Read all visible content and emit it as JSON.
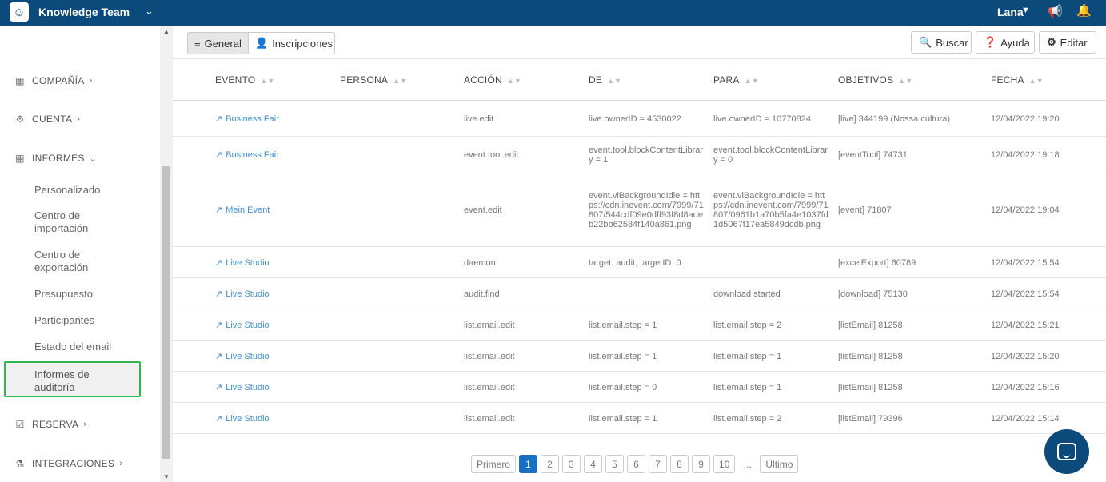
{
  "topbar": {
    "team": "Knowledge Team",
    "user": "Lana"
  },
  "sidebar": {
    "sections": [
      {
        "label": "COMPAÑÍA",
        "icon": "building-icon",
        "chevron": "›"
      },
      {
        "label": "CUENTA",
        "icon": "gear-icon",
        "chevron": "›"
      },
      {
        "label": "INFORMES",
        "icon": "report-icon",
        "chevron": "⌄"
      },
      {
        "label": "RESERVA",
        "icon": "calendar-icon",
        "chevron": "›"
      },
      {
        "label": "INTEGRACIONES",
        "icon": "flask-icon",
        "chevron": "›"
      }
    ],
    "subitems": [
      "Personalizado",
      "Centro de importación",
      "Centro de exportación",
      "Presupuesto",
      "Participantes",
      "Estado del email",
      "Informes de auditoría"
    ]
  },
  "toolbar": {
    "general": "General",
    "inscripciones": "Inscripciones",
    "buscar": "Buscar",
    "ayuda": "Ayuda",
    "editar": "Editar"
  },
  "table": {
    "headers": [
      "EVENTO",
      "PERSONA",
      "ACCIÓN",
      "DE",
      "PARA",
      "OBJETIVOS",
      "FECHA"
    ],
    "rows": [
      {
        "evento": "Business Fair",
        "persona": "",
        "accion": "live.edit",
        "de": "live.ownerID = 4530022",
        "para": "live.ownerID = 10770824",
        "objetivos": "[live] 344199 (Nossa cultura)",
        "fecha": "12/04/2022 19:20"
      },
      {
        "evento": "Business Fair",
        "persona": "",
        "accion": "event.tool.edit",
        "de": "event.tool.blockContentLibrary = 1",
        "para": "event.tool.blockContentLibrary = 0",
        "objetivos": "[eventTool] 74731",
        "fecha": "12/04/2022 19:18"
      },
      {
        "evento": "Mein Event",
        "persona": "",
        "accion": "event.edit",
        "de": "event.vlBackgroundIdle = https://cdn.inevent.com/7999/71807/544cdf09e0dff93f8d8adeb22bb62584f140a861.png",
        "para": "event.vlBackgroundIdle = https://cdn.inevent.com/7999/71807/0961b1a70b5fa4e1037fd1d5067f17ea5849dcdb.png",
        "objetivos": "[event] 71807",
        "fecha": "12/04/2022 19:04"
      },
      {
        "evento": "Live Studio",
        "persona": "",
        "accion": "daemon",
        "de": "target: audit, targetID: 0",
        "para": "",
        "objetivos": "[excelExport] 60789",
        "fecha": "12/04/2022 15:54"
      },
      {
        "evento": "Live Studio",
        "persona": "",
        "accion": "audit.find",
        "de": "",
        "para": "download started",
        "objetivos": "[download] 75130",
        "fecha": "12/04/2022 15:54"
      },
      {
        "evento": "Live Studio",
        "persona": "",
        "accion": "list.email.edit",
        "de": "list.email.step = 1",
        "para": "list.email.step = 2",
        "objetivos": "[listEmail] 81258",
        "fecha": "12/04/2022 15:21"
      },
      {
        "evento": "Live Studio",
        "persona": "",
        "accion": "list.email.edit",
        "de": "list.email.step = 1",
        "para": "list.email.step = 1",
        "objetivos": "[listEmail] 81258",
        "fecha": "12/04/2022 15:20"
      },
      {
        "evento": "Live Studio",
        "persona": "",
        "accion": "list.email.edit",
        "de": "list.email.step = 0",
        "para": "list.email.step = 1",
        "objetivos": "[listEmail] 81258",
        "fecha": "12/04/2022 15:16"
      },
      {
        "evento": "Live Studio",
        "persona": "",
        "accion": "list.email.edit",
        "de": "list.email.step = 1",
        "para": "list.email.step = 2",
        "objetivos": "[listEmail] 79396",
        "fecha": "12/04/2022 15:14"
      }
    ]
  },
  "pagination": {
    "first": "Primero",
    "pages": [
      "1",
      "2",
      "3",
      "4",
      "5",
      "6",
      "7",
      "8",
      "9",
      "10"
    ],
    "current": "1",
    "ellipsis": "...",
    "last": "Último"
  }
}
